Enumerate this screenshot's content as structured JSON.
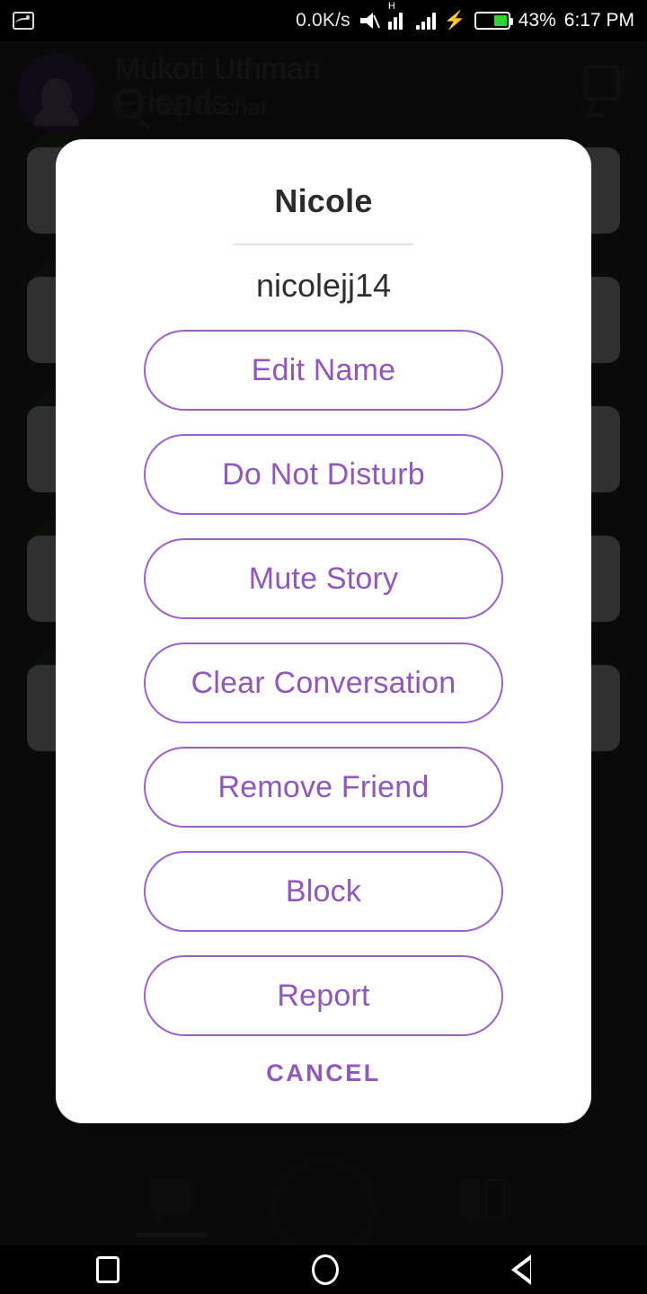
{
  "status_bar": {
    "notification_icon": "image-icon",
    "network_speed": "0.0K/s",
    "silent_icon": "mute-icon",
    "network_type": "H",
    "signal_icon_1": "signal-bars-icon",
    "signal_icon_2": "signal-bars-icon",
    "charging_icon": "charging-bolt-icon",
    "battery_icon": "battery-icon",
    "battery_percent": "43%",
    "time": "6:17 PM"
  },
  "background_app": {
    "profile_name": "Mukoti Uthman",
    "profile_subtitle": "Tap to chat",
    "search_placeholder": "Friends",
    "search_icon": "search-icon",
    "new_chat_icon": "new-chat-icon",
    "avatar": "bitmoji-avatar",
    "bottom_nav": {
      "chat_icon": "chat-bubble-icon",
      "camera_icon": "camera-capture-icon",
      "stories_icon": "stories-icon"
    }
  },
  "dialog": {
    "title": "Nicole",
    "username": "nicolejj14",
    "accent_color": "#9057bd",
    "border_color": "#9b63c9",
    "buttons": [
      {
        "label": "Edit Name"
      },
      {
        "label": "Do Not Disturb"
      },
      {
        "label": "Mute Story"
      },
      {
        "label": "Clear Conversation"
      },
      {
        "label": "Remove Friend"
      },
      {
        "label": "Block"
      },
      {
        "label": "Report"
      }
    ],
    "cancel_label": "CANCEL"
  },
  "nav_bar": {
    "recents_icon": "square-recents-icon",
    "home_icon": "circle-home-icon",
    "back_icon": "triangle-back-icon"
  }
}
